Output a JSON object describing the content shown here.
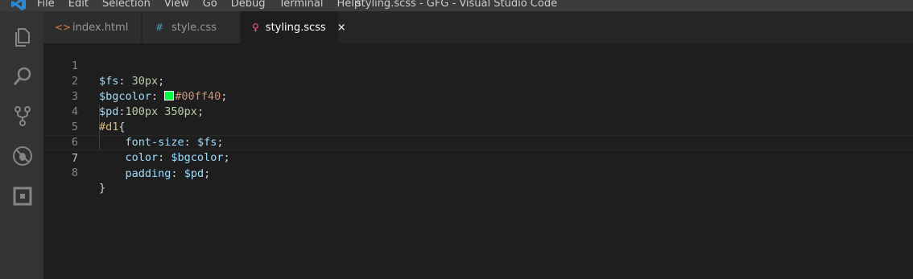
{
  "titlebar": {
    "menu": [
      "File",
      "Edit",
      "Selection",
      "View",
      "Go",
      "Debug",
      "Terminal",
      "Help"
    ],
    "window_title": "styling.scss - GFG - Visual Studio Code"
  },
  "activity_bar": {
    "icons": [
      "explorer-icon",
      "search-icon",
      "source-control-icon",
      "debug-icon",
      "extensions-icon"
    ]
  },
  "tabs": [
    {
      "label": "index.html",
      "icon": "html-file-icon",
      "icon_glyph": "<>",
      "icon_color": "#e37933",
      "active": false
    },
    {
      "label": "style.css",
      "icon": "css-file-icon",
      "icon_glyph": "#",
      "icon_color": "#519aba",
      "active": false
    },
    {
      "label": "styling.scss",
      "icon": "scss-file-icon",
      "icon_glyph": "♀",
      "icon_color": "#f55385",
      "active": true,
      "close": "×"
    }
  ],
  "editor": {
    "language": "scss",
    "current_line": 7,
    "color_swatch": "#00ff40",
    "lines": [
      {
        "number": "1",
        "text": "$fs: 30px;"
      },
      {
        "number": "2",
        "text": "$bgcolor: #00ff40;"
      },
      {
        "number": "3",
        "text": "$pd:100px 350px;"
      },
      {
        "number": "4",
        "text": "#d1{"
      },
      {
        "number": "5",
        "text": "    font-size: $fs;"
      },
      {
        "number": "6",
        "text": "    color: $bgcolor;"
      },
      {
        "number": "7",
        "text": "    padding: $pd;"
      },
      {
        "number": "8",
        "text": "}"
      }
    ]
  }
}
